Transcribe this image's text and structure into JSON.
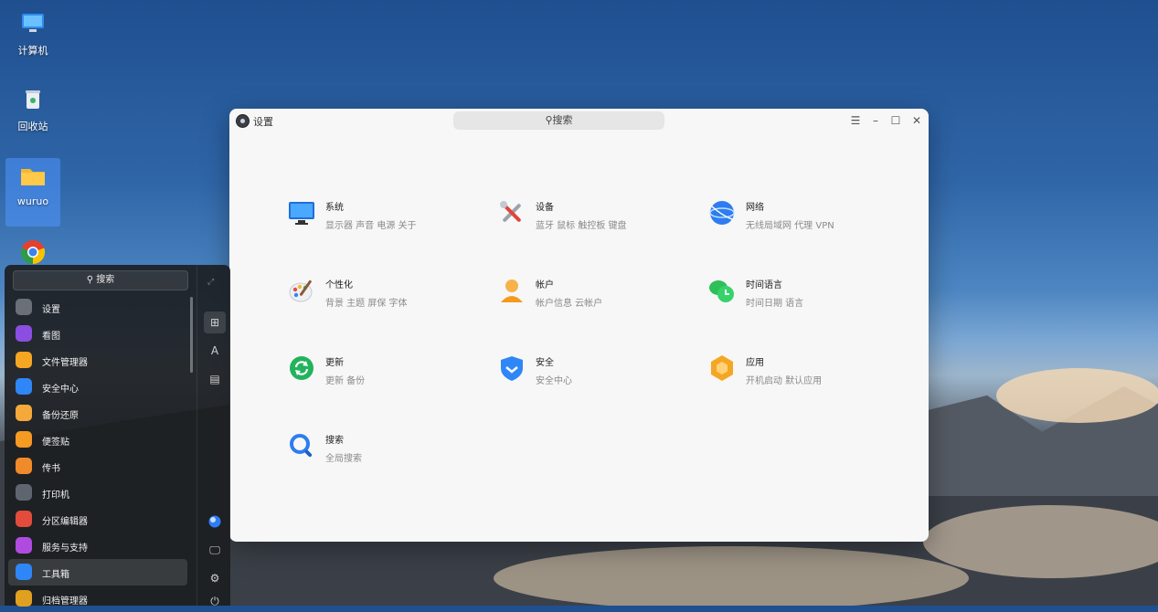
{
  "desktop": {
    "icons": [
      {
        "label": "计算机"
      },
      {
        "label": "回收站"
      },
      {
        "label": "wuruo"
      }
    ]
  },
  "window": {
    "title": "设置",
    "search_placeholder": "搜索",
    "controls": {
      "menu": "☰",
      "minimize": "–",
      "maximize": "☐",
      "close": "✕"
    },
    "items": [
      {
        "title": "系统",
        "subtitle": "显示器 声音 电源 关于"
      },
      {
        "title": "设备",
        "subtitle": "蓝牙 鼠标 触控板 键盘"
      },
      {
        "title": "网络",
        "subtitle": "无线局域网 代理 VPN"
      },
      {
        "title": "个性化",
        "subtitle": "背景 主题 屏保 字体"
      },
      {
        "title": "帐户",
        "subtitle": "帐户信息 云帐户"
      },
      {
        "title": "时间语言",
        "subtitle": "时间日期 语言"
      },
      {
        "title": "更新",
        "subtitle": "更新 备份"
      },
      {
        "title": "安全",
        "subtitle": "安全中心"
      },
      {
        "title": "应用",
        "subtitle": "开机启动 默认应用"
      },
      {
        "title": "搜索",
        "subtitle": "全局搜索"
      }
    ]
  },
  "launcher": {
    "search_placeholder": "搜索",
    "apps": [
      {
        "label": "设置",
        "color": "#6b6f78"
      },
      {
        "label": "看图",
        "color": "#8a4ee0"
      },
      {
        "label": "文件管理器",
        "color": "#f5a623"
      },
      {
        "label": "安全中心",
        "color": "#2f86f6"
      },
      {
        "label": "备份还原",
        "color": "#f4a93a"
      },
      {
        "label": "便签贴",
        "color": "#f59a23"
      },
      {
        "label": "传书",
        "color": "#f08a2a"
      },
      {
        "label": "打印机",
        "color": "#5f6570"
      },
      {
        "label": "分区编辑器",
        "color": "#e34b3b"
      },
      {
        "label": "服务与支持",
        "color": "#b04be0"
      },
      {
        "label": "工具箱",
        "color": "#2f86f6"
      },
      {
        "label": "归档管理器",
        "color": "#e0a020"
      }
    ],
    "active_index": 10
  }
}
